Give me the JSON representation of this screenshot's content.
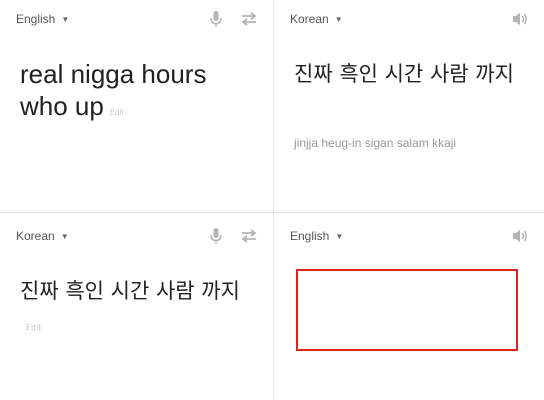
{
  "top_left": {
    "language": "English",
    "text": "real nigga hours who up",
    "edit_label": "Edit"
  },
  "top_right": {
    "language": "Korean",
    "text": "진짜 흑인 시간 사람 까지",
    "romanization": "jinjja heug-in sigan salam kkaji"
  },
  "bottom_left": {
    "language": "Korean",
    "text": "진짜 흑인 시간 사람 까지",
    "edit_label": "Edit"
  },
  "bottom_right": {
    "language": "English",
    "text": ""
  },
  "icons": {
    "mic": "microphone-icon",
    "swap": "swap-languages-icon",
    "speaker": "speaker-icon"
  },
  "colors": {
    "highlight_box": "#d9261c"
  }
}
